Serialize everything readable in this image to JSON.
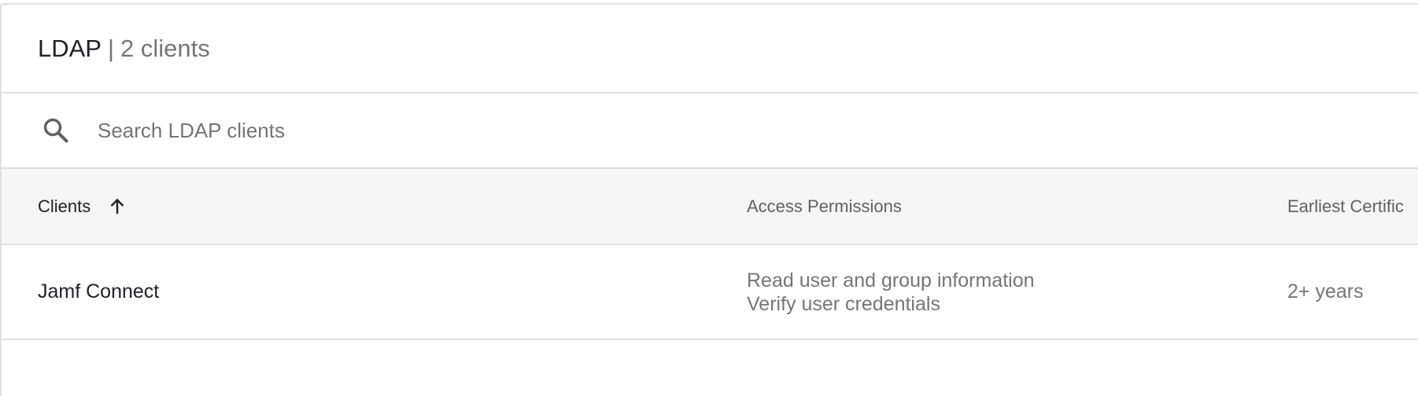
{
  "header": {
    "app_name": "LDAP",
    "separator": "|",
    "client_count": "2 clients"
  },
  "search": {
    "placeholder": "Search LDAP clients",
    "icon": "search-icon"
  },
  "table": {
    "columns": {
      "clients": "Clients",
      "access": "Access Permissions",
      "certificate": "Earliest Certific"
    },
    "sort": {
      "column": "clients",
      "direction": "ascending",
      "icon": "arrow-up-icon"
    },
    "rows": [
      {
        "client": "Jamf Connect",
        "permissions": [
          "Read user and group information",
          "Verify user credentials"
        ],
        "certificate": "2+ years"
      }
    ]
  },
  "colors": {
    "border": "#e0e0e0",
    "header_bg": "#f5f5f5",
    "primary_text": "#202124",
    "secondary_text": "#757575"
  }
}
